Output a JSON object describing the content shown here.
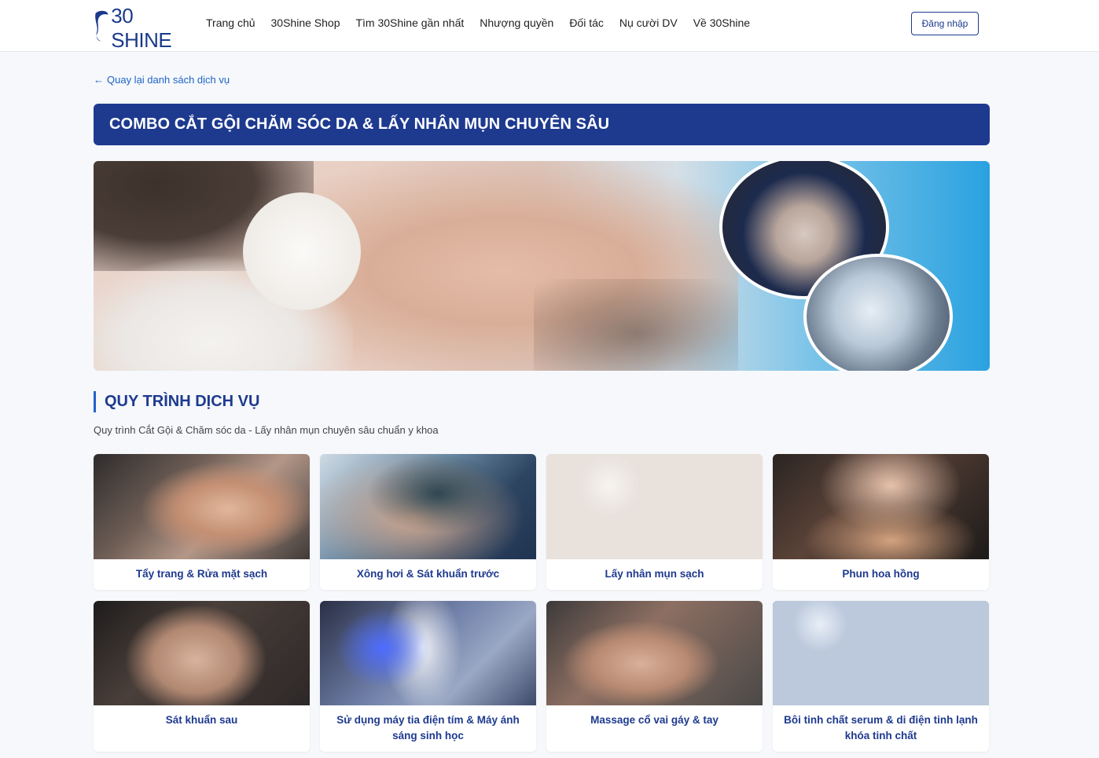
{
  "header": {
    "logo_text": "30 SHINE",
    "nav": [
      "Trang chủ",
      "30Shine Shop",
      "Tìm 30Shine gần nhất",
      "Nhượng quyền",
      "Đối tác",
      "Nụ cười DV",
      "Về 30Shine"
    ],
    "login_label": "Đăng nhập"
  },
  "back_link": "Quay lại danh sách dịch vụ",
  "title": "COMBO CẮT GỘI CHĂM SÓC DA & LẤY NHÂN MỤN CHUYÊN SÂU",
  "section": {
    "title": "QUY TRÌNH DỊCH VỤ",
    "subtitle": "Quy trình Cắt Gội & Chăm sóc da - Lấy nhân mụn chuyên sâu chuẩn y khoa"
  },
  "steps": [
    "Tẩy trang & Rửa mặt sạch",
    "Xông hơi & Sát khuẩn trước",
    "Lấy nhân mụn sạch",
    "Phun hoa hồng",
    "Sát khuẩn sau",
    "Sử dụng máy tia điện tím & Máy ánh sáng sinh học",
    "Massage cổ vai gáy & tay",
    "Bôi tinh chất serum & di điện tinh lạnh khóa tinh chất"
  ],
  "colors": {
    "brand": "#1e3a8f",
    "link": "#1e63c8",
    "background": "#f6f8fb"
  }
}
